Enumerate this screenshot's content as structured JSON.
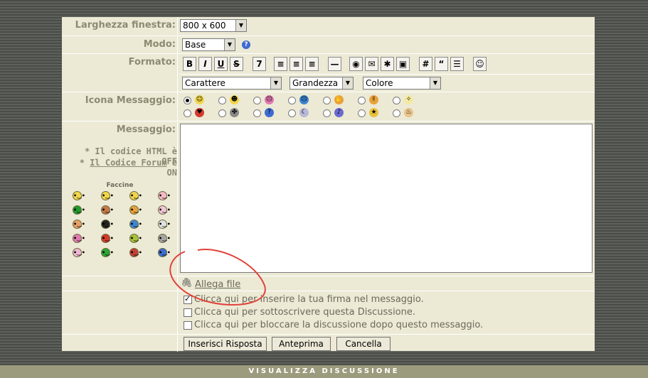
{
  "window": {
    "label": "Larghezza finestra:",
    "value": "800 x 600"
  },
  "mode": {
    "label": "Modo:",
    "value": "Base"
  },
  "format": {
    "label": "Formato:",
    "buttons": [
      {
        "icon": "bold-icon",
        "glyph": "B"
      },
      {
        "icon": "italic-icon",
        "glyph": "I"
      },
      {
        "icon": "underline-icon",
        "glyph": "U"
      },
      {
        "icon": "strikethrough-icon",
        "glyph": "S"
      },
      {
        "icon": "superscript-icon",
        "glyph": "7"
      },
      {
        "icon": "align-left-icon",
        "glyph": "≡"
      },
      {
        "icon": "align-center-icon",
        "glyph": "≡"
      },
      {
        "icon": "align-right-icon",
        "glyph": "≡"
      },
      {
        "icon": "horizontal-rule-icon",
        "glyph": "—"
      },
      {
        "icon": "globe-link-icon",
        "glyph": "◉"
      },
      {
        "icon": "email-link-icon",
        "glyph": "✉"
      },
      {
        "icon": "ftp-link-icon",
        "glyph": "✱"
      },
      {
        "icon": "image-icon",
        "glyph": "▣"
      },
      {
        "icon": "code-icon",
        "glyph": "#"
      },
      {
        "icon": "quote-icon",
        "glyph": "“"
      },
      {
        "icon": "list-icon",
        "glyph": "☰"
      },
      {
        "icon": "smiley-icon",
        "glyph": "☺"
      }
    ],
    "font_select": "Carattere",
    "size_select": "Grandezza",
    "color_select": "Colore"
  },
  "message_icon": {
    "label": "Icona Messaggio:",
    "row1": [
      "smiley-icon",
      "grin-icon",
      "shocked-icon",
      "sad-icon",
      "thumbs-down-icon",
      "thumbs-up-icon",
      "lightbulb-icon"
    ],
    "row2": [
      "heart-icon",
      "paw-icon",
      "question-icon",
      "moon-icon",
      "music-note-icon",
      "star-icon",
      "cake-icon"
    ]
  },
  "message": {
    "label": "Messaggio:",
    "html_note": "* Il codice HTML è OFF",
    "forum_note_prefix": "* ",
    "forum_note_link": "Il Codice Forum",
    "forum_note_suffix": " è ON",
    "smilies_title": "Faccine",
    "smilies": [
      [
        "#f1d64a",
        "#f1d64a",
        "#f1d64a",
        "#f4b9c8"
      ],
      [
        "#1f9a2c",
        "#c7784b",
        "#e9a13b",
        "#f0c6d6"
      ],
      [
        "#e8a06a",
        "#222222",
        "#3d86d1",
        "#e0e0e0"
      ],
      [
        "#e079b2",
        "#d43a2c",
        "#a8c23a",
        "#a5a5a5"
      ],
      [
        "#f0b7d2",
        "#2ca536",
        "#c44036",
        "#3d6bd1"
      ]
    ]
  },
  "attach": {
    "label": "Allega file"
  },
  "options": [
    {
      "checked": true,
      "text": "Clicca qui per inserire la tua firma nel messaggio."
    },
    {
      "checked": false,
      "text": "Clicca qui per sottoscrivere questa Discussione."
    },
    {
      "checked": false,
      "text": "Clicca qui per bloccare la discussione dopo questo messaggio."
    }
  ],
  "actions": {
    "reply": "Inserisci Risposta",
    "preview": "Anteprima",
    "cancel": "Cancella"
  },
  "footer": {
    "text": "VISUALIZZA DISCUSSIONE"
  }
}
